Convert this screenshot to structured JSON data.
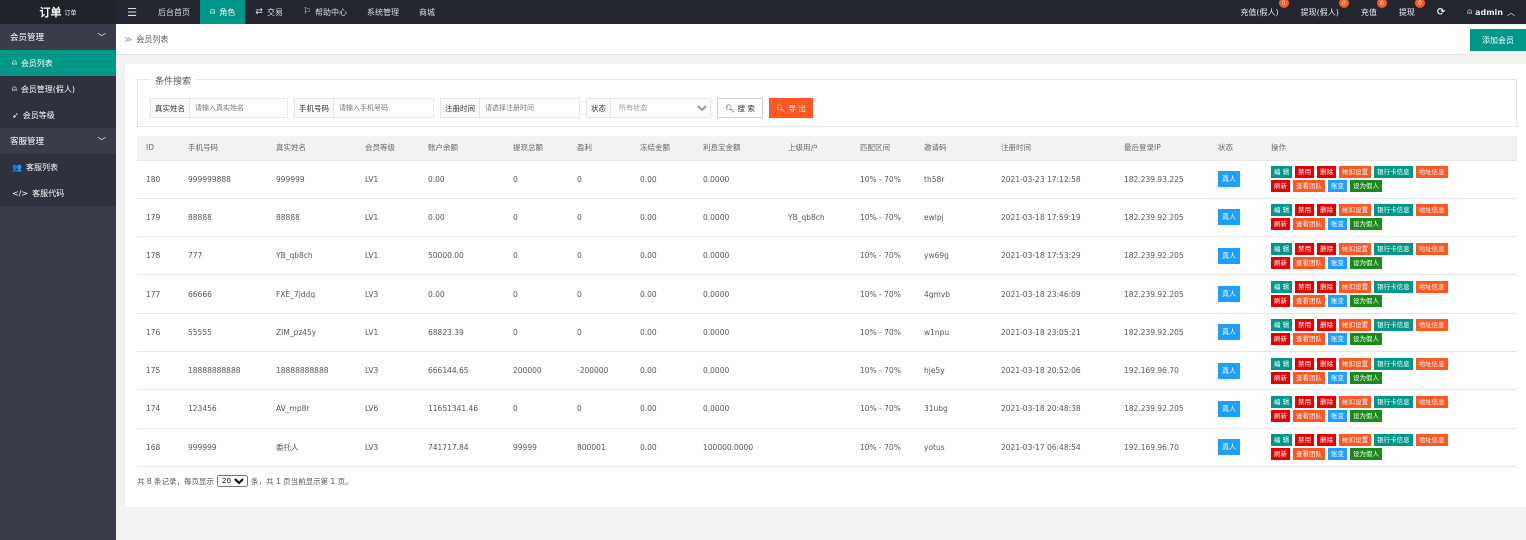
{
  "header": {
    "logo": "订单",
    "logo_sup": "订单",
    "menu_icon": "menu-icon",
    "nav": [
      {
        "label": "后台首页"
      },
      {
        "label": "角色",
        "icon": "user-icon",
        "active": true
      },
      {
        "label": "交易",
        "icon": "exchange-icon"
      },
      {
        "label": "帮助中心",
        "icon": "flag-icon"
      },
      {
        "label": "系统管理"
      },
      {
        "label": "商城"
      }
    ],
    "right": [
      {
        "label": "充值(假人)",
        "badge": "0"
      },
      {
        "label": "提现(假人)",
        "badge": "0"
      },
      {
        "label": "充值",
        "badge": "0"
      },
      {
        "label": "提现",
        "badge": "0"
      }
    ],
    "refresh_icon": "refresh-icon",
    "user": "admin"
  },
  "sidebar": {
    "groups": [
      {
        "label": "会员管理",
        "items": [
          {
            "label": "会员列表",
            "icon": "user-icon",
            "active": true
          },
          {
            "label": "会员管理(假人)",
            "icon": "user-icon"
          },
          {
            "label": "会员等级",
            "icon": "rocket-icon"
          }
        ]
      },
      {
        "label": "客服管理",
        "items": [
          {
            "label": "客服列表",
            "icon": "users-icon"
          },
          {
            "label": "客服代码",
            "icon": "code-icon"
          }
        ]
      }
    ]
  },
  "breadcrumb": "会员列表",
  "add_button": "添加会员",
  "search": {
    "legend": "条件搜索",
    "realname_label": "真实姓名",
    "realname_placeholder": "请输入真实姓名",
    "phone_label": "手机号码",
    "phone_placeholder": "请输入手机号码",
    "regtime_label": "注册时间",
    "regtime_placeholder": "请选择注册时间",
    "status_label": "状态",
    "status_value": "所有状态",
    "search_btn": "搜 索",
    "export_btn": "导 出"
  },
  "table": {
    "columns": [
      "ID",
      "手机号码",
      "真实姓名",
      "会员等级",
      "账户余额",
      "提现总额",
      "盈利",
      "冻结金额",
      "利息宝金额",
      "上级用户",
      "匹配区间",
      "邀请码",
      "注册时间",
      "最后登录IP",
      "状态",
      "操作"
    ],
    "rows": [
      [
        "180",
        "999999888",
        "999999",
        "LV1",
        "0.00",
        "0",
        "0",
        "0.00",
        "0.0000",
        "",
        "10% - 70%",
        "th58r",
        "2021-03-23 17:12:58",
        "182.239.93.225",
        "真人"
      ],
      [
        "179",
        "88888",
        "88888",
        "LV1",
        "0.00",
        "0",
        "0",
        "0.00",
        "0.0000",
        "YB_qb8ch",
        "10% - 70%",
        "ewlpj",
        "2021-03-18 17:59:19",
        "182.239.92.205",
        "真人"
      ],
      [
        "178",
        "777",
        "YB_qb8ch",
        "LV1",
        "50000.00",
        "0",
        "0",
        "0.00",
        "0.0000",
        "",
        "10% - 70%",
        "yw69g",
        "2021-03-18 17:53:29",
        "182.239.92.205",
        "真人"
      ],
      [
        "177",
        "66666",
        "FXE_7jddq",
        "LV3",
        "0.00",
        "0",
        "0",
        "0.00",
        "0.0000",
        "",
        "10% - 70%",
        "4gmvb",
        "2021-03-18 23:46:09",
        "182.239.92.205",
        "真人"
      ],
      [
        "176",
        "55555",
        "ZIM_pz45y",
        "LV1",
        "68823.39",
        "0",
        "0",
        "0.00",
        "0.0000",
        "",
        "10% - 70%",
        "w1npu",
        "2021-03-18 23:05:21",
        "182.239.92.205",
        "真人"
      ],
      [
        "175",
        "18888888888",
        "18888888888",
        "LV3",
        "666144.65",
        "200000",
        "-200000",
        "0.00",
        "0.0000",
        "",
        "10% - 70%",
        "hje5y",
        "2021-03-18 20:52:06",
        "192.169.96.70",
        "真人"
      ],
      [
        "174",
        "123456",
        "AV_mp8r",
        "LV6",
        "11651341.46",
        "0",
        "0",
        "0.00",
        "0.0000",
        "",
        "10% - 70%",
        "31ubg",
        "2021-03-18 20:48:38",
        "182.239.92.205",
        "真人"
      ],
      [
        "168",
        "999999",
        "委托人",
        "LV3",
        "741717.84",
        "99999",
        "800001",
        "0.00",
        "100000.0000",
        "",
        "10% - 70%",
        "yotus",
        "2021-03-17 06:48:54",
        "192.169.96.70",
        "真人"
      ]
    ],
    "ops": [
      {
        "label": "编 辑",
        "color": "teal"
      },
      {
        "label": "禁用",
        "color": "red"
      },
      {
        "label": "删除",
        "color": "red"
      },
      {
        "label": "帐扣设置",
        "color": "orange"
      },
      {
        "label": "银行卡信息",
        "color": "teal"
      },
      {
        "label": "地址信息",
        "color": "orange"
      },
      {
        "label": "刷新",
        "color": "red"
      },
      {
        "label": "查看团队",
        "color": "orange"
      },
      {
        "label": "账变",
        "color": "blue"
      },
      {
        "label": "设为假人",
        "color": "green"
      }
    ]
  },
  "pager": {
    "prefix": "共 8 条记录，每页显示",
    "page_size": "20",
    "suffix": "条，共 1 页当前显示第 1 页。"
  }
}
